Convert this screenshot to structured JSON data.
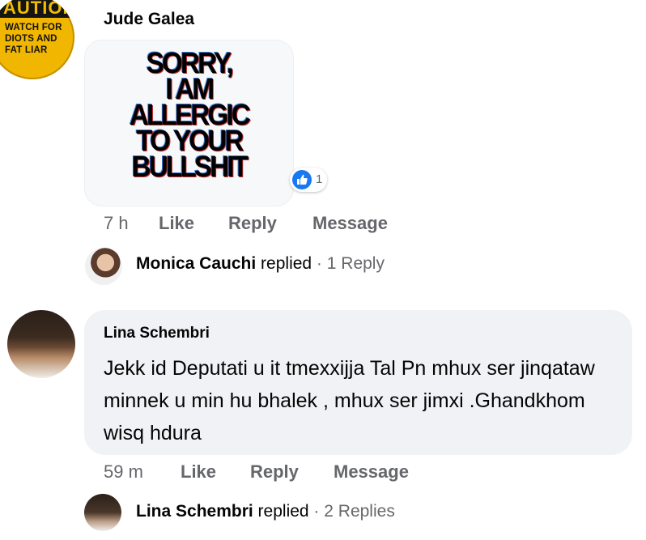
{
  "comment1": {
    "avatar": {
      "top_text": "AUTION",
      "lines": [
        "WATCH FOR",
        "DIOTS AND",
        "FAT LIAR"
      ]
    },
    "author": "Jude Galea",
    "sticker": {
      "lines": [
        "SORRY,",
        "I AM",
        "ALLERGIC",
        "TO YOUR",
        "BULLSHIT"
      ]
    },
    "reaction": {
      "icon": "thumbs-up-icon",
      "count": "1",
      "color": "#1877f2"
    },
    "time": "7 h",
    "actions": [
      "Like",
      "Reply",
      "Message"
    ],
    "replies": {
      "name": "Monica Cauchi",
      "verb": "replied",
      "sep": " · ",
      "count": "1 Reply"
    }
  },
  "comment2": {
    "author": "Lina Schembri",
    "text": "Jekk id Deputati u it tmexxijja Tal Pn mhux ser jinqataw minnek u min hu bhalek , mhux ser jimxi .Ghandkhom wisq hdura",
    "time": "59 m",
    "actions": [
      "Like",
      "Reply",
      "Message"
    ],
    "replies": {
      "name": "Lina Schembri",
      "verb": "replied",
      "sep": " · ",
      "count": "2 Replies"
    }
  },
  "colors": {
    "bubble_bg": "#f0f2f5",
    "meta_text": "#65676b",
    "like_blue": "#1877f2"
  }
}
